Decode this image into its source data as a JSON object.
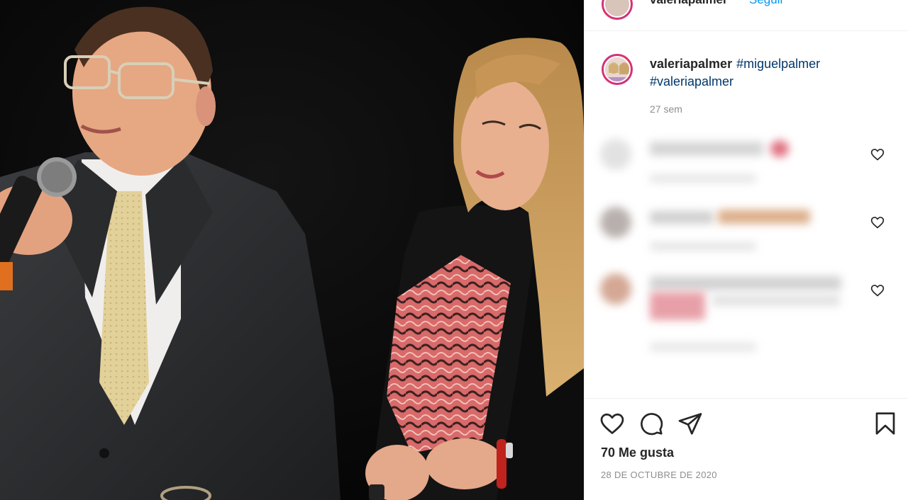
{
  "post": {
    "username": "valeriapalmer",
    "follow_label": "Seguir",
    "caption_username": "valeriapalmer",
    "hashtags": [
      "#miguelpalmer",
      "#valeriapalmer"
    ],
    "caption_time": "27 sem",
    "likes_text": "70 Me gusta",
    "date_text": "28 DE OCTUBRE DE 2020"
  },
  "icons": {
    "like": "heart-outline-icon",
    "comment": "speech-bubble-icon",
    "share": "paper-plane-icon",
    "save": "bookmark-icon",
    "comment_like": "small-heart-icon"
  },
  "colors": {
    "link": "#00376b",
    "follow": "#0095f6",
    "muted": "#8e8e8e",
    "ring": "#c13584"
  }
}
